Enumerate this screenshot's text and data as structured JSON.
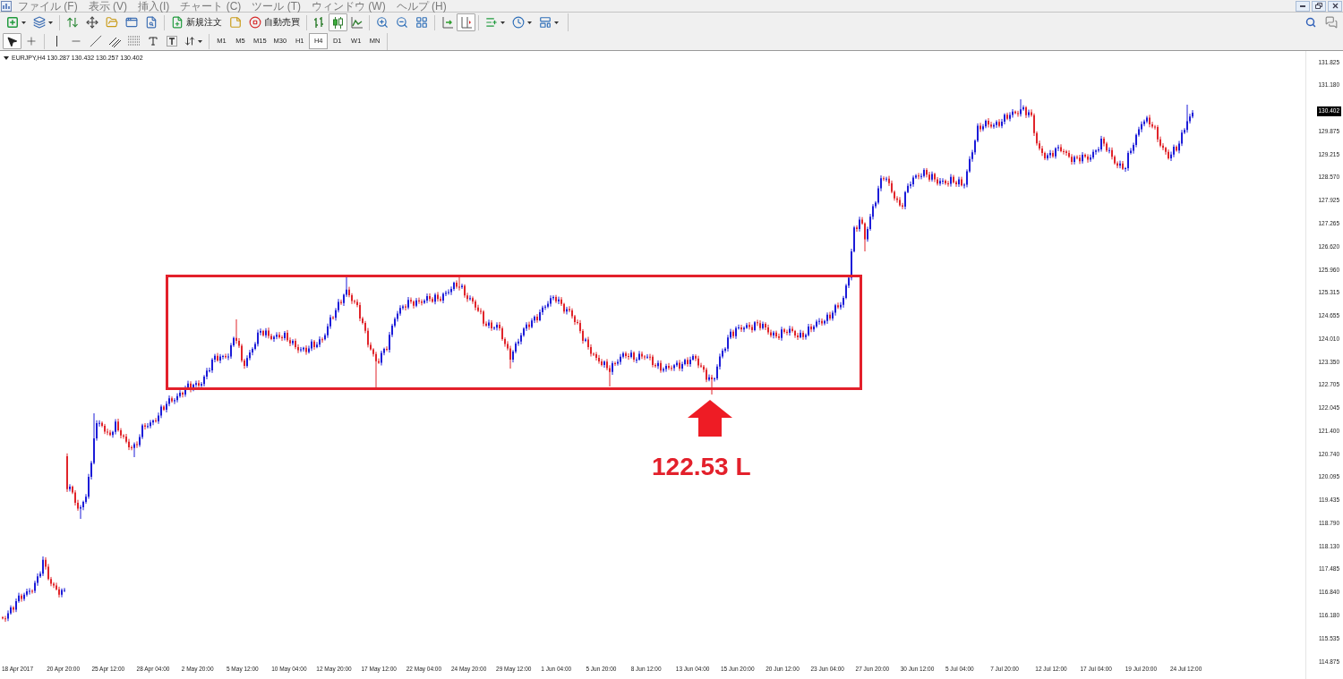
{
  "menu": {
    "items": [
      "ファイル (F)",
      "表示 (V)",
      "挿入(I)",
      "チャート (C)",
      "ツール (T)",
      "ウィンドウ (W)",
      "ヘルプ (H)"
    ]
  },
  "toolbar": {
    "new_order": "新規注文",
    "auto_trading": "自動売買",
    "chart_types": [
      {
        "selected": false
      },
      {
        "selected": true
      },
      {
        "selected": false
      }
    ],
    "auto_scroll": {
      "on": false
    },
    "chart_shift": {
      "on": true
    }
  },
  "line_studies": {
    "pointer_modes": [
      {
        "selected": true
      },
      {
        "selected": false
      }
    ]
  },
  "timeframes": [
    {
      "label": "M1",
      "selected": false
    },
    {
      "label": "M5",
      "selected": false
    },
    {
      "label": "M15",
      "selected": false
    },
    {
      "label": "M30",
      "selected": false
    },
    {
      "label": "H1",
      "selected": false
    },
    {
      "label": "H4",
      "selected": true
    },
    {
      "label": "D1",
      "selected": false
    },
    {
      "label": "W1",
      "selected": false
    },
    {
      "label": "MN",
      "selected": false
    }
  ],
  "chart": {
    "header": "EURJPY,H4 130.287 130.432 130.257 130.402",
    "annotation": "122.53 L",
    "price_axis": [
      {
        "kind": "tick",
        "text": "131.825"
      },
      {
        "kind": "tick",
        "text": "131.180"
      },
      {
        "kind": "current",
        "text": "130.402"
      },
      {
        "kind": "tick",
        "text": "129.875"
      },
      {
        "kind": "tick",
        "text": "129.215"
      },
      {
        "kind": "tick",
        "text": "128.570"
      },
      {
        "kind": "tick",
        "text": "127.925"
      },
      {
        "kind": "tick",
        "text": "127.265"
      },
      {
        "kind": "tick",
        "text": "126.620"
      },
      {
        "kind": "tick",
        "text": "125.960"
      },
      {
        "kind": "tick",
        "text": "125.315"
      },
      {
        "kind": "tick",
        "text": "124.655"
      },
      {
        "kind": "tick",
        "text": "124.010"
      },
      {
        "kind": "tick",
        "text": "123.350"
      },
      {
        "kind": "tick",
        "text": "122.705"
      },
      {
        "kind": "tick",
        "text": "122.045"
      },
      {
        "kind": "tick",
        "text": "121.400"
      },
      {
        "kind": "tick",
        "text": "120.740"
      },
      {
        "kind": "tick",
        "text": "120.095"
      },
      {
        "kind": "tick",
        "text": "119.435"
      },
      {
        "kind": "tick",
        "text": "118.790"
      },
      {
        "kind": "tick",
        "text": "118.130"
      },
      {
        "kind": "tick",
        "text": "117.485"
      },
      {
        "kind": "tick",
        "text": "116.840"
      },
      {
        "kind": "tick",
        "text": "116.180"
      },
      {
        "kind": "tick",
        "text": "115.535"
      },
      {
        "kind": "tick",
        "text": "114.875"
      }
    ],
    "time_axis": [
      "18 Apr 2017",
      "20 Apr 20:00",
      "25 Apr 12:00",
      "28 Apr 04:00",
      "2 May 20:00",
      "5 May 12:00",
      "10 May 04:00",
      "12 May 20:00",
      "17 May 12:00",
      "22 May 04:00",
      "24 May 20:00",
      "29 May 12:00",
      "1 Jun 04:00",
      "5 Jun 20:00",
      "8 Jun 12:00",
      "13 Jun 04:00",
      "15 Jun 20:00",
      "20 Jun 12:00",
      "23 Jun 04:00",
      "27 Jun 20:00",
      "30 Jun 12:00",
      "5 Jul 04:00",
      "7 Jul 20:00",
      "12 Jul 12:00",
      "17 Jul 04:00",
      "19 Jul 20:00",
      "24 Jul 12:00"
    ]
  }
}
